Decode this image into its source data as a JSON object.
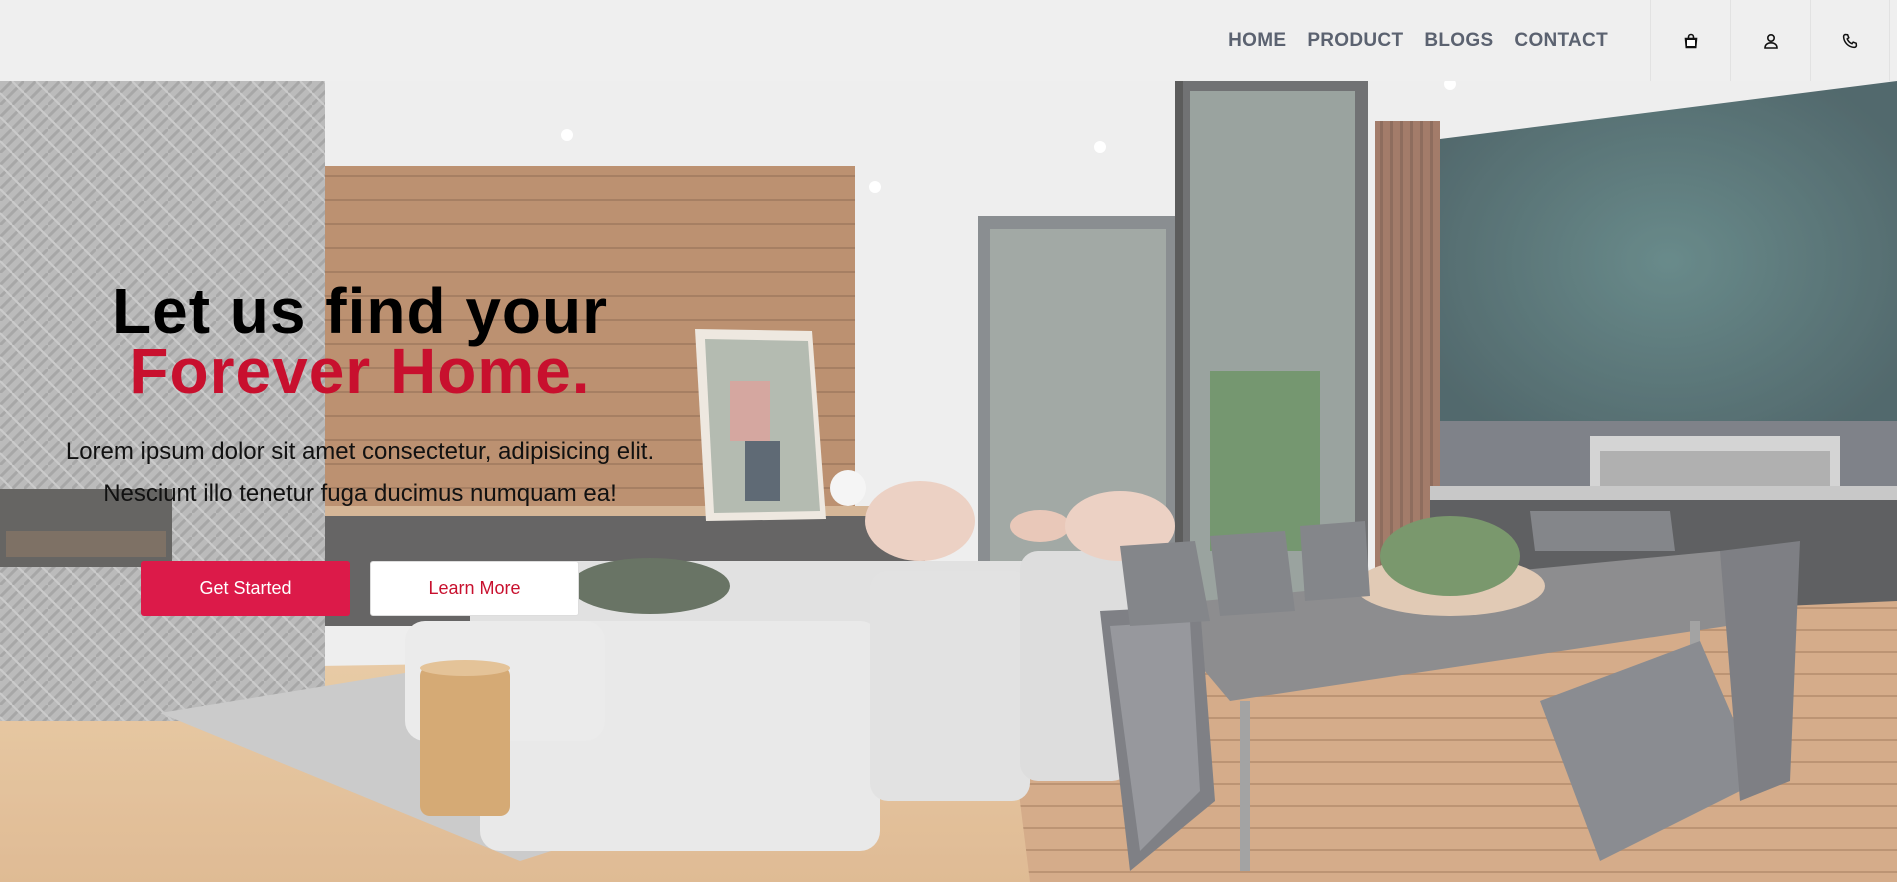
{
  "nav": {
    "links": [
      "HOME",
      "PRODUCT",
      "BLOGS",
      "CONTACT"
    ],
    "icons": [
      "shopping-bag-icon",
      "user-icon",
      "phone-icon"
    ]
  },
  "hero": {
    "title_line1": "Let us find your",
    "title_line2": "Forever Home.",
    "subtitle_line1": "Lorem ipsum dolor sit amet consectetur, adipisicing elit.",
    "subtitle_line2": "Nesciunt illo tenetur fuga ducimus numquam ea!",
    "primary_button": "Get Started",
    "secondary_button": "Learn More"
  },
  "colors": {
    "accent": "#dc1a49",
    "title_accent": "#c8102e",
    "nav_text": "#5b6270",
    "nav_bg": "#efefef"
  }
}
